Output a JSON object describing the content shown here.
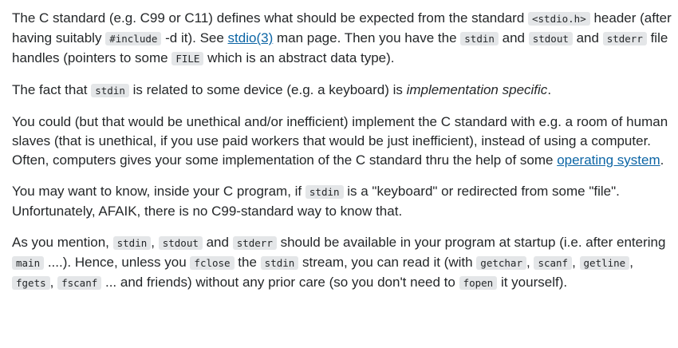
{
  "paragraphs": [
    {
      "segments": [
        {
          "type": "text",
          "text": "The C standard (e.g. C99 or C11) defines what should be expected from the standard "
        },
        {
          "type": "code",
          "text": "<stdio.h>"
        },
        {
          "type": "text",
          "text": " header (after having suitably "
        },
        {
          "type": "code",
          "text": "#include"
        },
        {
          "type": "text",
          "text": " -d it). See "
        },
        {
          "type": "link",
          "text": "stdio(3)"
        },
        {
          "type": "text",
          "text": " man page. Then you have the "
        },
        {
          "type": "code",
          "text": "stdin"
        },
        {
          "type": "text",
          "text": " and "
        },
        {
          "type": "code",
          "text": "stdout"
        },
        {
          "type": "text",
          "text": " and "
        },
        {
          "type": "code",
          "text": "stderr"
        },
        {
          "type": "text",
          "text": " file handles (pointers to some "
        },
        {
          "type": "code",
          "text": "FILE"
        },
        {
          "type": "text",
          "text": " which is an abstract data type)."
        }
      ]
    },
    {
      "segments": [
        {
          "type": "text",
          "text": "The fact that "
        },
        {
          "type": "code",
          "text": "stdin"
        },
        {
          "type": "text",
          "text": " is related to some device (e.g. a keyboard) is "
        },
        {
          "type": "em",
          "text": "implementation specific"
        },
        {
          "type": "text",
          "text": "."
        }
      ]
    },
    {
      "segments": [
        {
          "type": "text",
          "text": "You could (but that would be unethical and/or inefficient) implement the C standard with e.g. a room of human slaves (that is unethical, if you use paid workers that would be just inefficient), instead of using a computer. Often, computers gives your some implementation of the C standard thru the help of some "
        },
        {
          "type": "link",
          "text": "operating system"
        },
        {
          "type": "text",
          "text": "."
        }
      ]
    },
    {
      "segments": [
        {
          "type": "text",
          "text": "You may want to know, inside your C program, if "
        },
        {
          "type": "code",
          "text": "stdin"
        },
        {
          "type": "text",
          "text": " is a \"keyboard\" or redirected from some \"file\". Unfortunately, AFAIK, there is no C99-standard way to know that."
        }
      ]
    },
    {
      "segments": [
        {
          "type": "text",
          "text": "As you mention, "
        },
        {
          "type": "code",
          "text": "stdin"
        },
        {
          "type": "text",
          "text": ", "
        },
        {
          "type": "code",
          "text": "stdout"
        },
        {
          "type": "text",
          "text": " and "
        },
        {
          "type": "code",
          "text": "stderr"
        },
        {
          "type": "text",
          "text": " should be available in your program at startup (i.e. after entering "
        },
        {
          "type": "code",
          "text": "main"
        },
        {
          "type": "text",
          "text": " ....). Hence, unless you "
        },
        {
          "type": "code",
          "text": "fclose"
        },
        {
          "type": "text",
          "text": " the "
        },
        {
          "type": "code",
          "text": "stdin"
        },
        {
          "type": "text",
          "text": " stream, you can read it (with "
        },
        {
          "type": "code",
          "text": "getchar"
        },
        {
          "type": "text",
          "text": ", "
        },
        {
          "type": "code",
          "text": "scanf"
        },
        {
          "type": "text",
          "text": ", "
        },
        {
          "type": "code",
          "text": "getline"
        },
        {
          "type": "text",
          "text": ", "
        },
        {
          "type": "code",
          "text": "fgets"
        },
        {
          "type": "text",
          "text": ", "
        },
        {
          "type": "code",
          "text": "fscanf"
        },
        {
          "type": "text",
          "text": " ... and friends) without any prior care (so you don't need to "
        },
        {
          "type": "code",
          "text": "fopen"
        },
        {
          "type": "text",
          "text": " it yourself)."
        }
      ]
    }
  ]
}
